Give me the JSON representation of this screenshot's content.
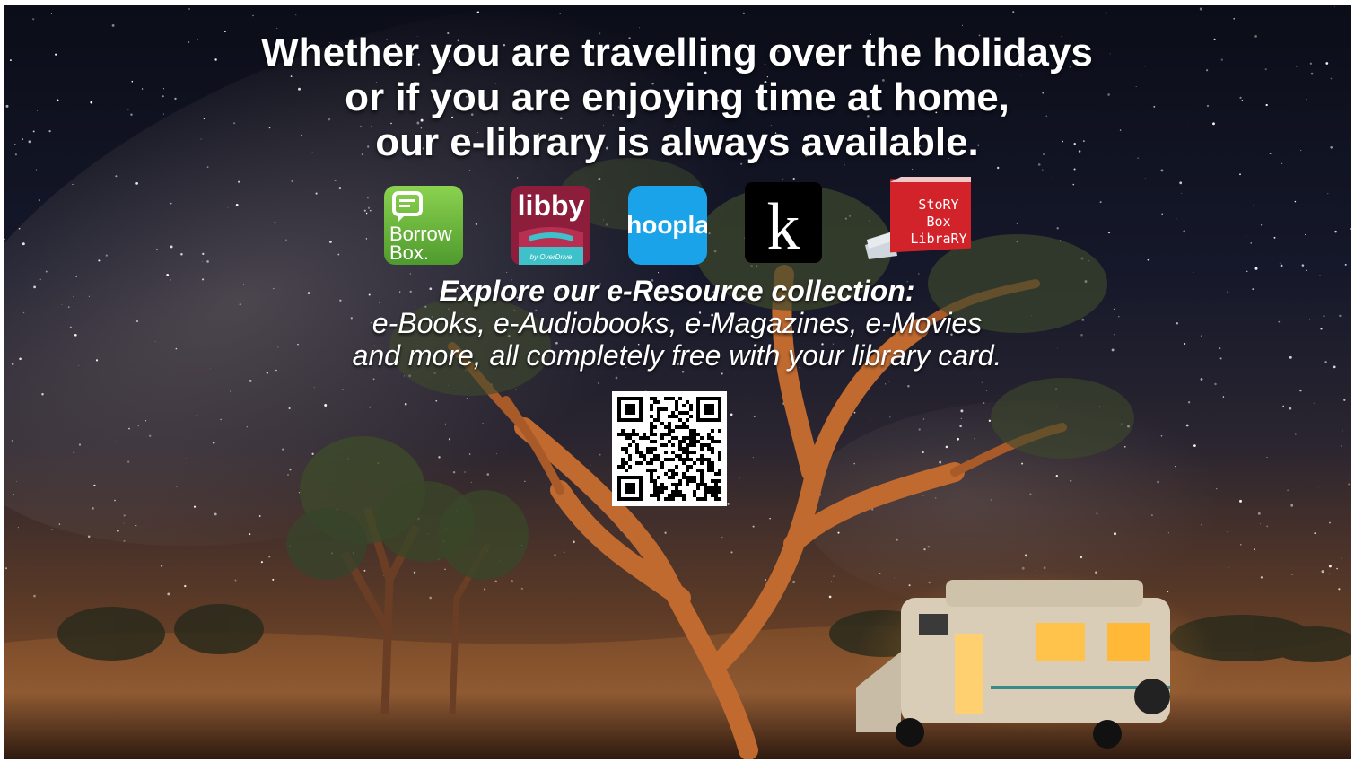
{
  "headline": {
    "line1": "Whether you are travelling over the holidays",
    "line2": "or if you are enjoying time at home,",
    "line3": "our e-library is always available."
  },
  "apps": [
    {
      "name": "BorrowBox",
      "label_line1": "Borrow",
      "label_line2": "Box.",
      "icon": "borrowbox-icon",
      "color": "#6cc04a"
    },
    {
      "name": "Libby",
      "label": "libby",
      "sublabel": "by OverDrive",
      "icon": "libby-icon",
      "color": "#8c1e3c"
    },
    {
      "name": "hoopla",
      "label": "hoopla",
      "icon": "hoopla-icon",
      "color": "#1aa3e8"
    },
    {
      "name": "Kanopy",
      "label": "k",
      "icon": "kanopy-icon",
      "color": "#000000"
    },
    {
      "name": "Story Box Library",
      "label_line1": "StoRY",
      "label_line2": "Box",
      "label_line3": "LibraRY",
      "icon": "story-box-library-icon",
      "color": "#d2232a"
    }
  ],
  "explore": {
    "lead": "Explore our e-Resource collection:",
    "line2": "e-Books, e-Audiobooks, e-Magazines, e-Movies",
    "line3": "and more, all completely free with your library card."
  },
  "qr": {
    "icon": "qr-code-icon"
  }
}
